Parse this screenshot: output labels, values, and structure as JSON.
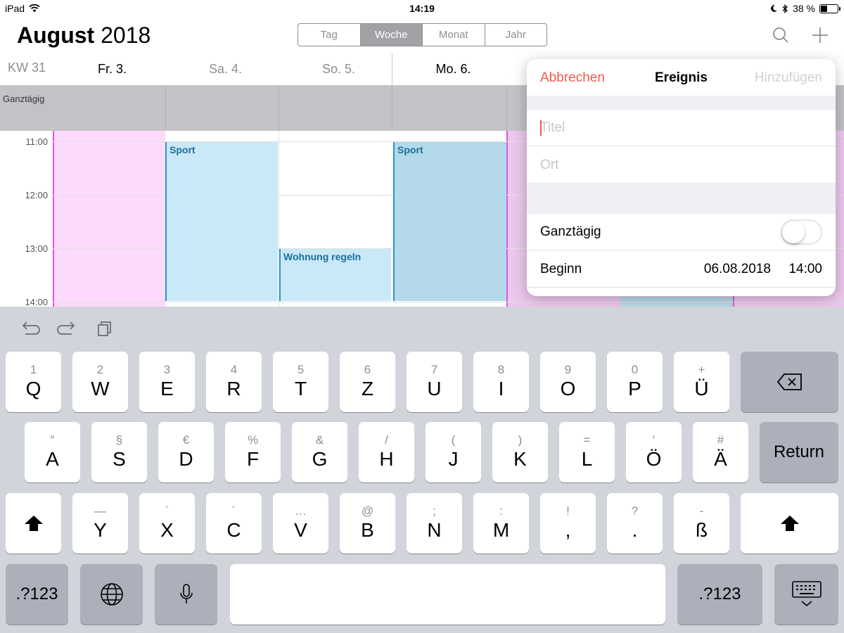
{
  "status": {
    "device": "iPad",
    "time": "14:19",
    "battery": "38 %",
    "battery_level": 0.38
  },
  "header": {
    "month": "August",
    "year": "2018",
    "segments": [
      "Tag",
      "Woche",
      "Monat",
      "Jahr"
    ],
    "active_segment": "Woche"
  },
  "week": {
    "kw": "KW 31",
    "days": [
      "Fr. 3.",
      "Sa. 4.",
      "So. 5.",
      "Mo. 6."
    ],
    "all_day_label": "Ganztägig",
    "hours": [
      "11:00",
      "12:00",
      "13:00",
      "14:00"
    ],
    "events": [
      {
        "title": "Sport",
        "day": "Sa. 4."
      },
      {
        "title": "Wohnung regeln",
        "day": "So. 5."
      },
      {
        "title": "Sport",
        "day": "Mo. 6."
      }
    ]
  },
  "popover": {
    "cancel": "Abbrechen",
    "title": "Ereignis",
    "add": "Hinzufügen",
    "title_placeholder": "Titel",
    "location_placeholder": "Ort",
    "all_day": "Ganztägig",
    "all_day_on": false,
    "start_label": "Beginn",
    "start_date": "06.08.2018",
    "start_time": "14:00"
  },
  "keyboard": {
    "row1": [
      {
        "main": "Q",
        "alt": "1"
      },
      {
        "main": "W",
        "alt": "2"
      },
      {
        "main": "E",
        "alt": "3"
      },
      {
        "main": "R",
        "alt": "4"
      },
      {
        "main": "T",
        "alt": "5"
      },
      {
        "main": "Z",
        "alt": "6"
      },
      {
        "main": "U",
        "alt": "7"
      },
      {
        "main": "I",
        "alt": "8"
      },
      {
        "main": "O",
        "alt": "9"
      },
      {
        "main": "P",
        "alt": "0"
      },
      {
        "main": "Ü",
        "alt": "+"
      }
    ],
    "row2": [
      {
        "main": "A",
        "alt": "″"
      },
      {
        "main": "S",
        "alt": "§"
      },
      {
        "main": "D",
        "alt": "€"
      },
      {
        "main": "F",
        "alt": "%"
      },
      {
        "main": "G",
        "alt": "&"
      },
      {
        "main": "H",
        "alt": "/"
      },
      {
        "main": "J",
        "alt": "("
      },
      {
        "main": "K",
        "alt": ")"
      },
      {
        "main": "L",
        "alt": "="
      },
      {
        "main": "Ö",
        "alt": "′"
      },
      {
        "main": "Ä",
        "alt": "#"
      }
    ],
    "row3": [
      {
        "main": "Y",
        "alt": "—"
      },
      {
        "main": "X",
        "alt": "`"
      },
      {
        "main": "C",
        "alt": "´"
      },
      {
        "main": "V",
        "alt": "…"
      },
      {
        "main": "B",
        "alt": "@"
      },
      {
        "main": "N",
        "alt": ";"
      },
      {
        "main": "M",
        "alt": ":"
      },
      {
        "main": ",",
        "alt": "!"
      },
      {
        "main": ".",
        "alt": "?"
      },
      {
        "main": "ß",
        "alt": "-"
      }
    ],
    "return_label": "Return",
    "numbers_label": ".?123"
  }
}
